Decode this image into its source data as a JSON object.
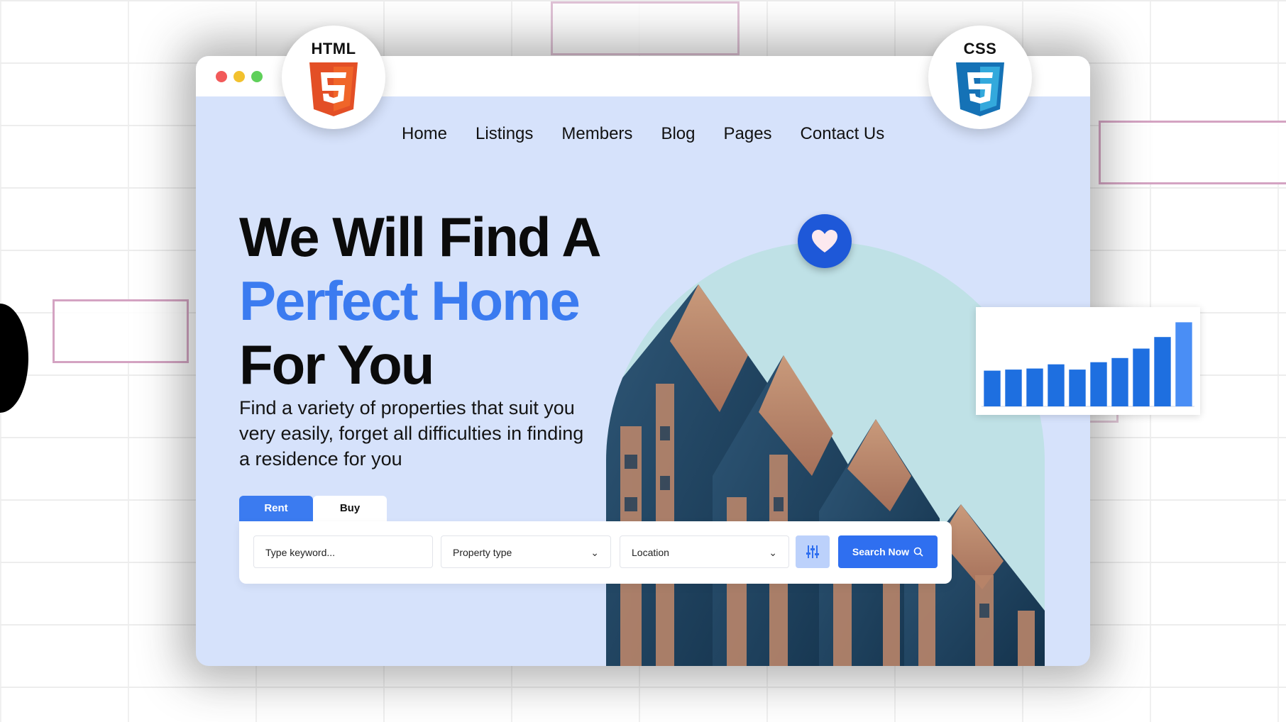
{
  "badges": {
    "html": "HTML",
    "css": "CSS"
  },
  "nav": [
    "Home",
    "Listings",
    "Members",
    "Blog",
    "Pages",
    "Contact Us"
  ],
  "hero": {
    "line1": "We Will Find A",
    "line2": "Perfect Home",
    "line3": "For You",
    "subtitle": "Find a variety of properties that suit you very easily, forget all difficulties in finding a residence for you"
  },
  "tabs": {
    "rent": "Rent",
    "buy": "Buy"
  },
  "search": {
    "keyword_placeholder": "Type keyword...",
    "property_type": "Property type",
    "location": "Location",
    "button": "Search Now"
  },
  "icons": [
    "heart-icon",
    "sliders-icon",
    "search-icon",
    "chevron-down-icon",
    "html5-icon",
    "css3-icon"
  ],
  "colors": {
    "accent": "#3b7bf0",
    "hero_bg": "#d6e2fb",
    "button": "#2f6ff0"
  },
  "chart_data": {
    "type": "bar",
    "values": [
      34,
      35,
      36,
      40,
      35,
      42,
      46,
      55,
      66,
      80
    ],
    "ylim": [
      0,
      85
    ]
  }
}
